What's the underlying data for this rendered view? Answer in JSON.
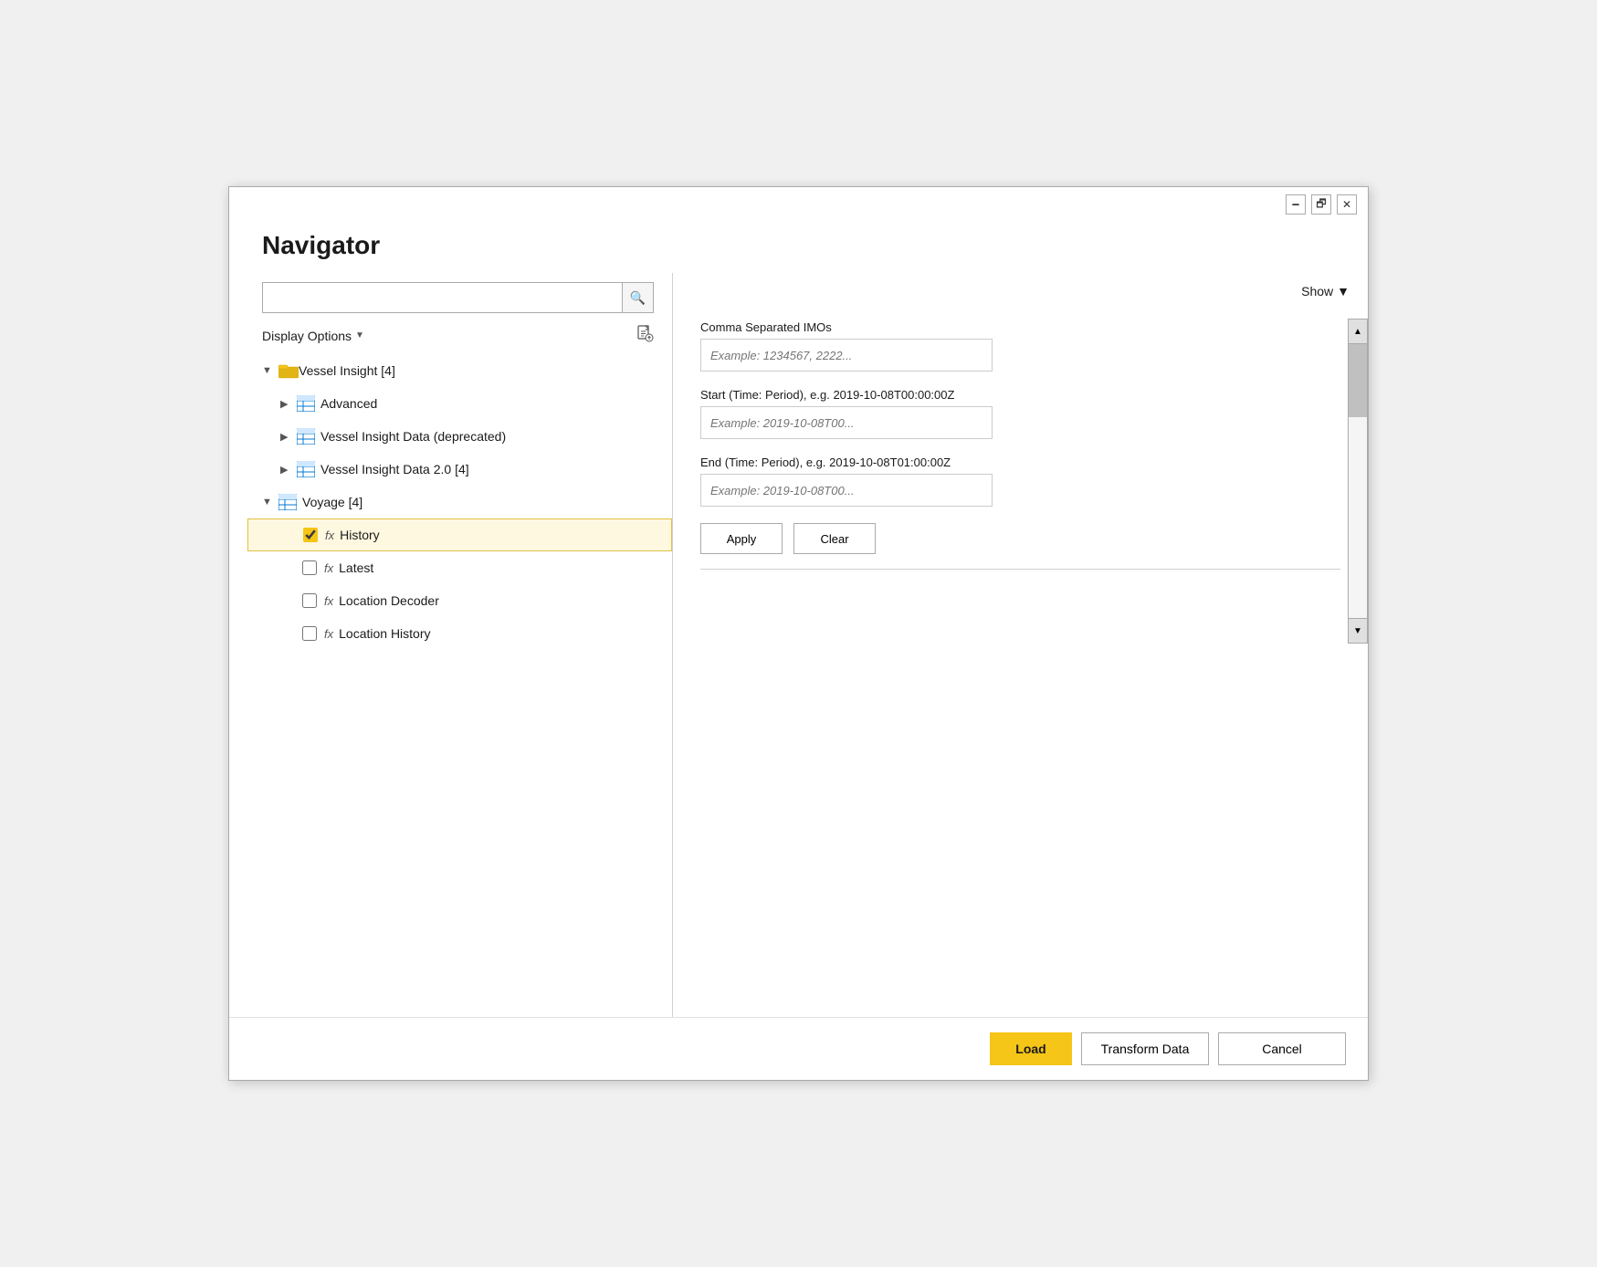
{
  "window": {
    "title": "Navigator",
    "title_bar": {
      "minimize_label": "🗕",
      "restore_label": "🗗",
      "close_label": "✕"
    }
  },
  "search": {
    "placeholder": "",
    "icon": "🔍"
  },
  "display_options": {
    "label": "Display Options",
    "chevron": "▼",
    "export_icon": "📄"
  },
  "tree": {
    "items": [
      {
        "id": "vessel-insight",
        "level": 0,
        "type": "folder",
        "label": "Vessel Insight [4]",
        "expanded": true,
        "selected": false,
        "checked": null
      },
      {
        "id": "advanced",
        "level": 1,
        "type": "table",
        "label": "Advanced",
        "expanded": false,
        "selected": false,
        "checked": false
      },
      {
        "id": "vessel-insight-deprecated",
        "level": 1,
        "type": "table",
        "label": "Vessel Insight Data (deprecated)",
        "expanded": false,
        "selected": false,
        "checked": false
      },
      {
        "id": "vessel-insight-2",
        "level": 1,
        "type": "table",
        "label": "Vessel Insight Data 2.0 [4]",
        "expanded": false,
        "selected": false,
        "checked": false
      },
      {
        "id": "voyage",
        "level": 0,
        "type": "table-folder",
        "label": "Voyage [4]",
        "expanded": true,
        "selected": false,
        "checked": null
      },
      {
        "id": "history",
        "level": 1,
        "type": "fx",
        "label": "History",
        "expanded": false,
        "selected": true,
        "checked": true
      },
      {
        "id": "latest",
        "level": 1,
        "type": "fx",
        "label": "Latest",
        "expanded": false,
        "selected": false,
        "checked": false
      },
      {
        "id": "location-decoder",
        "level": 1,
        "type": "fx",
        "label": "Location Decoder",
        "expanded": false,
        "selected": false,
        "checked": false
      },
      {
        "id": "location-history",
        "level": 1,
        "type": "fx",
        "label": "Location History",
        "expanded": false,
        "selected": false,
        "checked": false
      }
    ]
  },
  "right_panel": {
    "show_label": "Show",
    "show_chevron": "▼",
    "form": {
      "imo_label": "Comma Separated IMOs",
      "imo_placeholder": "Example: 1234567, 2222...",
      "start_label": "Start (Time: Period), e.g. 2019-10-08T00:00:00Z",
      "start_placeholder": "Example: 2019-10-08T00...",
      "end_label": "End (Time: Period), e.g. 2019-10-08T01:00:00Z",
      "end_placeholder": "Example: 2019-10-08T00...",
      "apply_label": "Apply",
      "clear_label": "Clear"
    }
  },
  "footer": {
    "load_label": "Load",
    "transform_label": "Transform Data",
    "cancel_label": "Cancel"
  }
}
